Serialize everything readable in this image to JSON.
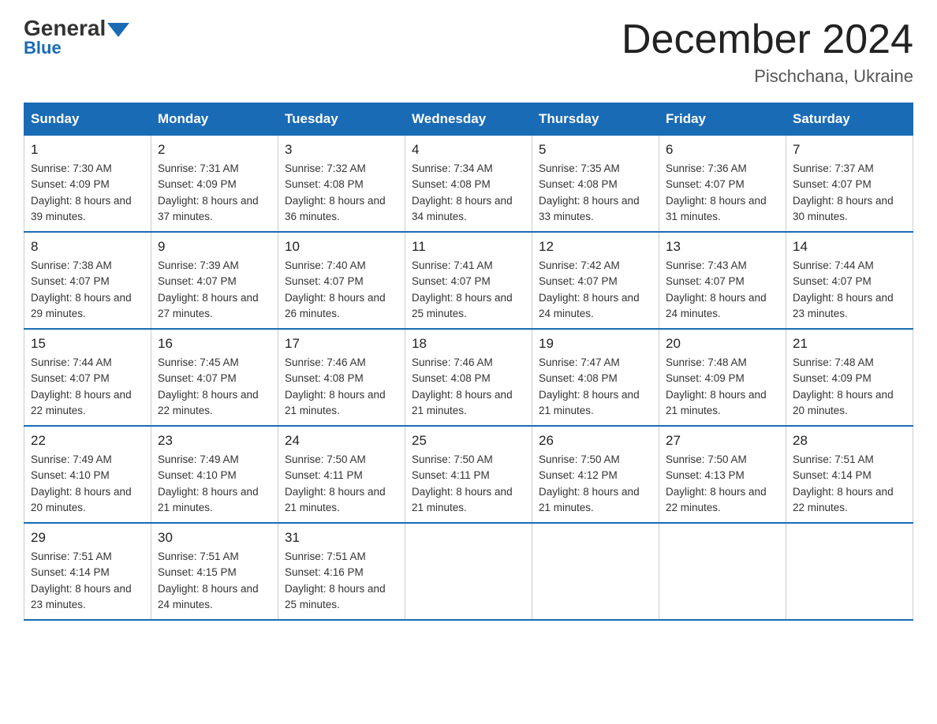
{
  "logo": {
    "general": "General",
    "blue": "Blue"
  },
  "header": {
    "month": "December 2024",
    "location": "Pischchana, Ukraine"
  },
  "days_of_week": [
    "Sunday",
    "Monday",
    "Tuesday",
    "Wednesday",
    "Thursday",
    "Friday",
    "Saturday"
  ],
  "weeks": [
    [
      {
        "day": "1",
        "sunrise": "7:30 AM",
        "sunset": "4:09 PM",
        "daylight": "8 hours and 39 minutes."
      },
      {
        "day": "2",
        "sunrise": "7:31 AM",
        "sunset": "4:09 PM",
        "daylight": "8 hours and 37 minutes."
      },
      {
        "day": "3",
        "sunrise": "7:32 AM",
        "sunset": "4:08 PM",
        "daylight": "8 hours and 36 minutes."
      },
      {
        "day": "4",
        "sunrise": "7:34 AM",
        "sunset": "4:08 PM",
        "daylight": "8 hours and 34 minutes."
      },
      {
        "day": "5",
        "sunrise": "7:35 AM",
        "sunset": "4:08 PM",
        "daylight": "8 hours and 33 minutes."
      },
      {
        "day": "6",
        "sunrise": "7:36 AM",
        "sunset": "4:07 PM",
        "daylight": "8 hours and 31 minutes."
      },
      {
        "day": "7",
        "sunrise": "7:37 AM",
        "sunset": "4:07 PM",
        "daylight": "8 hours and 30 minutes."
      }
    ],
    [
      {
        "day": "8",
        "sunrise": "7:38 AM",
        "sunset": "4:07 PM",
        "daylight": "8 hours and 29 minutes."
      },
      {
        "day": "9",
        "sunrise": "7:39 AM",
        "sunset": "4:07 PM",
        "daylight": "8 hours and 27 minutes."
      },
      {
        "day": "10",
        "sunrise": "7:40 AM",
        "sunset": "4:07 PM",
        "daylight": "8 hours and 26 minutes."
      },
      {
        "day": "11",
        "sunrise": "7:41 AM",
        "sunset": "4:07 PM",
        "daylight": "8 hours and 25 minutes."
      },
      {
        "day": "12",
        "sunrise": "7:42 AM",
        "sunset": "4:07 PM",
        "daylight": "8 hours and 24 minutes."
      },
      {
        "day": "13",
        "sunrise": "7:43 AM",
        "sunset": "4:07 PM",
        "daylight": "8 hours and 24 minutes."
      },
      {
        "day": "14",
        "sunrise": "7:44 AM",
        "sunset": "4:07 PM",
        "daylight": "8 hours and 23 minutes."
      }
    ],
    [
      {
        "day": "15",
        "sunrise": "7:44 AM",
        "sunset": "4:07 PM",
        "daylight": "8 hours and 22 minutes."
      },
      {
        "day": "16",
        "sunrise": "7:45 AM",
        "sunset": "4:07 PM",
        "daylight": "8 hours and 22 minutes."
      },
      {
        "day": "17",
        "sunrise": "7:46 AM",
        "sunset": "4:08 PM",
        "daylight": "8 hours and 21 minutes."
      },
      {
        "day": "18",
        "sunrise": "7:46 AM",
        "sunset": "4:08 PM",
        "daylight": "8 hours and 21 minutes."
      },
      {
        "day": "19",
        "sunrise": "7:47 AM",
        "sunset": "4:08 PM",
        "daylight": "8 hours and 21 minutes."
      },
      {
        "day": "20",
        "sunrise": "7:48 AM",
        "sunset": "4:09 PM",
        "daylight": "8 hours and 21 minutes."
      },
      {
        "day": "21",
        "sunrise": "7:48 AM",
        "sunset": "4:09 PM",
        "daylight": "8 hours and 20 minutes."
      }
    ],
    [
      {
        "day": "22",
        "sunrise": "7:49 AM",
        "sunset": "4:10 PM",
        "daylight": "8 hours and 20 minutes."
      },
      {
        "day": "23",
        "sunrise": "7:49 AM",
        "sunset": "4:10 PM",
        "daylight": "8 hours and 21 minutes."
      },
      {
        "day": "24",
        "sunrise": "7:50 AM",
        "sunset": "4:11 PM",
        "daylight": "8 hours and 21 minutes."
      },
      {
        "day": "25",
        "sunrise": "7:50 AM",
        "sunset": "4:11 PM",
        "daylight": "8 hours and 21 minutes."
      },
      {
        "day": "26",
        "sunrise": "7:50 AM",
        "sunset": "4:12 PM",
        "daylight": "8 hours and 21 minutes."
      },
      {
        "day": "27",
        "sunrise": "7:50 AM",
        "sunset": "4:13 PM",
        "daylight": "8 hours and 22 minutes."
      },
      {
        "day": "28",
        "sunrise": "7:51 AM",
        "sunset": "4:14 PM",
        "daylight": "8 hours and 22 minutes."
      }
    ],
    [
      {
        "day": "29",
        "sunrise": "7:51 AM",
        "sunset": "4:14 PM",
        "daylight": "8 hours and 23 minutes."
      },
      {
        "day": "30",
        "sunrise": "7:51 AM",
        "sunset": "4:15 PM",
        "daylight": "8 hours and 24 minutes."
      },
      {
        "day": "31",
        "sunrise": "7:51 AM",
        "sunset": "4:16 PM",
        "daylight": "8 hours and 25 minutes."
      },
      null,
      null,
      null,
      null
    ]
  ]
}
